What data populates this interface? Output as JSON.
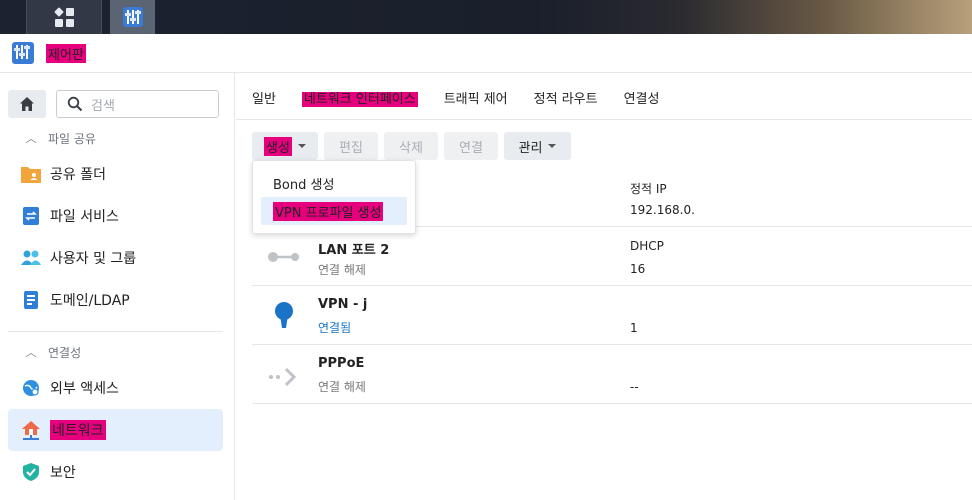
{
  "app": {
    "title": "제어판"
  },
  "sidebar": {
    "search_placeholder": "검색",
    "sections": [
      {
        "label": "파일 공유"
      },
      {
        "label": "연결성"
      }
    ],
    "items": [
      {
        "label": "공유 폴더"
      },
      {
        "label": "파일 서비스"
      },
      {
        "label": "사용자 및 그룹"
      },
      {
        "label": "도메인/LDAP"
      },
      {
        "label": "외부 액세스"
      },
      {
        "label": "네트워크"
      },
      {
        "label": "보안"
      }
    ]
  },
  "tabs": [
    {
      "label": "일반"
    },
    {
      "label": "네트워크 인터페이스"
    },
    {
      "label": "트래픽 제어"
    },
    {
      "label": "정적 라우트"
    },
    {
      "label": "연결성"
    }
  ],
  "toolbar": {
    "create": "생성",
    "edit": "편집",
    "delete": "삭제",
    "connect": "연결",
    "manage": "관리"
  },
  "dropdown": {
    "items": [
      {
        "label": "Bond 생성"
      },
      {
        "label": "VPN 프로파일 생성"
      }
    ]
  },
  "interfaces": [
    {
      "name": "",
      "status": "",
      "col1": "정적 IP",
      "col2": "192.168.0."
    },
    {
      "name": "LAN 포트 2",
      "status": "연결 해제",
      "col1": "DHCP",
      "col2": "16"
    },
    {
      "name": "VPN - j",
      "status": "연결됨",
      "col1": "",
      "col2": "1"
    },
    {
      "name": "PPPoE",
      "status": "연결 해제",
      "col1": "",
      "col2": "--"
    }
  ],
  "colors": {
    "accent": "#1a73c7",
    "highlight": "#e6007e",
    "active_bg": "#e3effc"
  }
}
